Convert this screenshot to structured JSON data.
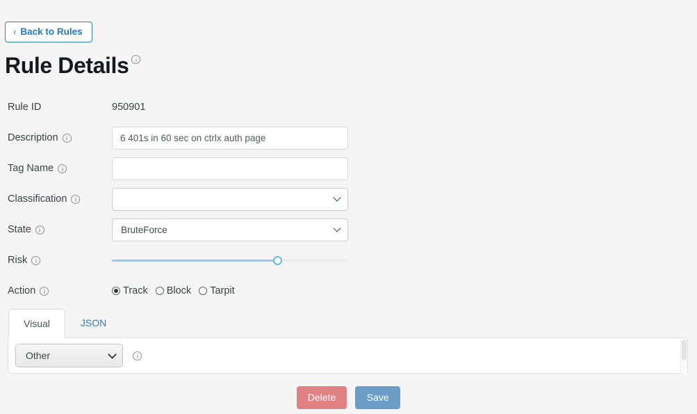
{
  "nav": {
    "back_label": "Back to Rules",
    "back_icon": "chevron-left-icon"
  },
  "header": {
    "title": "Rule Details",
    "info_icon": "info-icon"
  },
  "form": {
    "rule_id": {
      "label": "Rule ID",
      "value": "950901",
      "has_info": false
    },
    "description": {
      "label": "Description",
      "value": "6 401s in 60 sec on ctrlx auth page",
      "placeholder": "",
      "has_info": true
    },
    "tag_name": {
      "label": "Tag Name",
      "value": "",
      "placeholder": "",
      "has_info": true
    },
    "classification": {
      "label": "Classification",
      "value": "",
      "options": [
        ""
      ],
      "has_info": true
    },
    "state": {
      "label": "State",
      "value": "BruteForce",
      "options": [
        "BruteForce"
      ],
      "has_info": true
    },
    "risk": {
      "label": "Risk",
      "value": 70,
      "min": 0,
      "max": 100,
      "has_info": true,
      "fill_color": "#8fcbf2",
      "thumb_color": "#63b8ef"
    },
    "action": {
      "label": "Action",
      "has_info": true,
      "selected": "Track",
      "options": [
        {
          "label": "Track",
          "checked": true
        },
        {
          "label": "Block",
          "checked": false
        },
        {
          "label": "Tarpit",
          "checked": false
        }
      ]
    }
  },
  "tabs": {
    "items": [
      {
        "label": "Visual",
        "active": true
      },
      {
        "label": "JSON",
        "active": false
      }
    ]
  },
  "panel": {
    "condition_select": {
      "value": "Other",
      "options": [
        "Other"
      ]
    },
    "info_icon": "info-icon"
  },
  "footer": {
    "delete_label": "Delete",
    "save_label": "Save",
    "delete_color": "#e08283",
    "save_color": "#6c9dc6"
  }
}
